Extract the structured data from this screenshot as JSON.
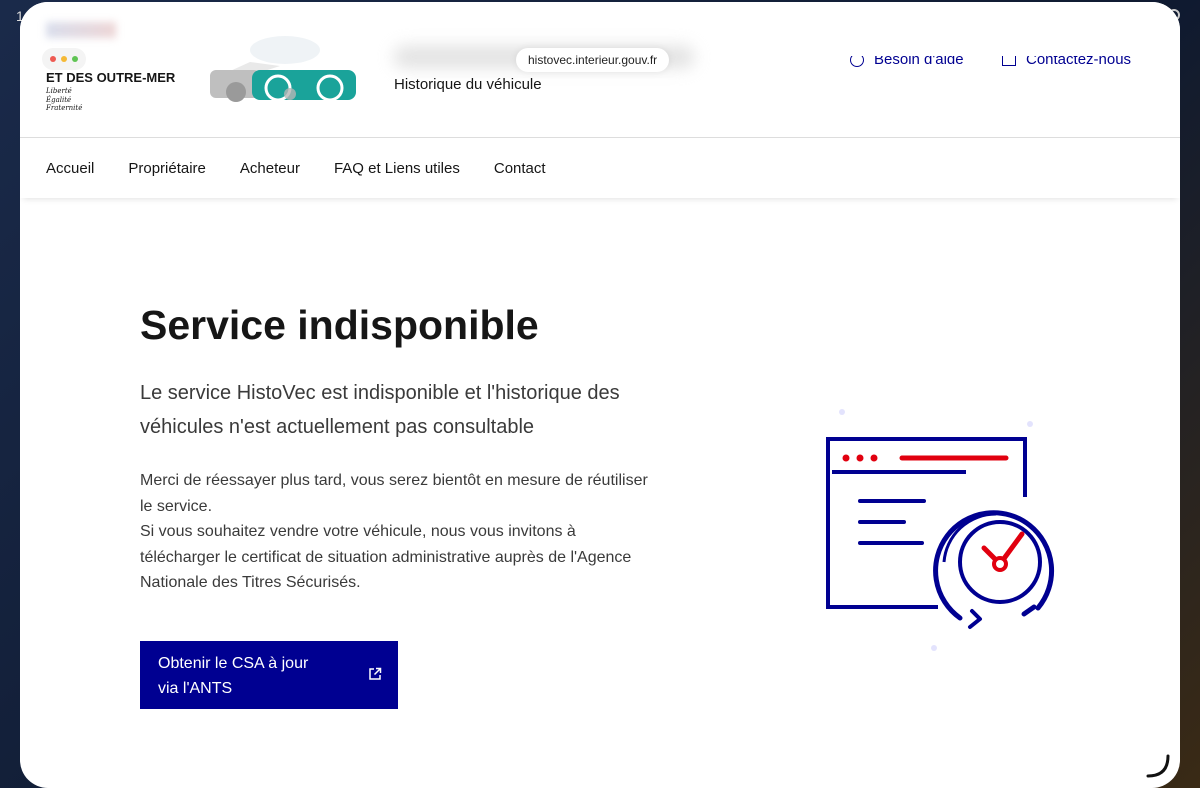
{
  "status_bar": {
    "time": "1"
  },
  "header": {
    "ministry": "ET DES OUTRE-MER",
    "motto": [
      "Liberté",
      "Égalité",
      "Fraternité"
    ],
    "url": "histovec.interieur.gouv.fr",
    "subtitle": "Historique du véhicule",
    "tools": {
      "help": "Besoin d'aide",
      "contact": "Contactez-nous"
    }
  },
  "nav": {
    "items": [
      "Accueil",
      "Propriétaire",
      "Acheteur",
      "FAQ et Liens utiles",
      "Contact"
    ]
  },
  "main": {
    "title": "Service indisponible",
    "lead": "Le service HistoVec est indisponible et l'historique des véhicules n'est actuellement pas consultable",
    "paragraph_1": "Merci de réessayer plus tard, vous serez bientôt en mesure de réutiliser le service.",
    "paragraph_2": "Si vous souhaitez vendre votre véhicule, nous vous invitons à télécharger le certificat de situation administrative auprès de l'Agence Nationale des Titres Sécurisés.",
    "cta": {
      "line1": "Obtenir le CSA à jour",
      "line2": "via l'ANTS"
    }
  },
  "colors": {
    "primary": "#000091",
    "accent_red": "#e1000f",
    "teal": "#1aa39a",
    "text": "#161616"
  },
  "icons": {
    "external_link": "external-link-icon",
    "help": "question-circle-icon",
    "contact": "mail-icon",
    "illustration": "browser-clock-icon"
  }
}
